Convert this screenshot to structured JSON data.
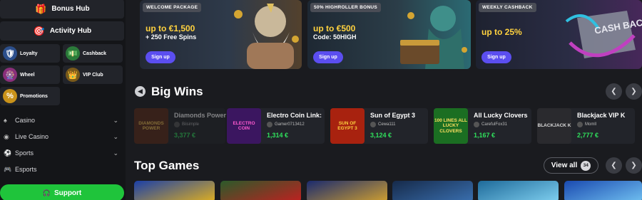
{
  "sidebar": {
    "bonus_hub": "Bonus Hub",
    "activity_hub": "Activity Hub",
    "tiles": [
      {
        "label": "Loyalty",
        "icon": "shield-icon"
      },
      {
        "label": "Cashback",
        "icon": "cash-icon"
      },
      {
        "label": "Wheel",
        "icon": "wheel-icon"
      },
      {
        "label": "VIP Club",
        "icon": "crown-icon"
      },
      {
        "label": "Promotions",
        "icon": "percent-icon"
      }
    ],
    "nav": [
      {
        "label": "Casino",
        "icon": "casino-icon",
        "expandable": true
      },
      {
        "label": "Live Casino",
        "icon": "live-icon",
        "expandable": true
      },
      {
        "label": "Sports",
        "icon": "sports-icon",
        "expandable": true
      },
      {
        "label": "Esports",
        "icon": "gamepad-icon",
        "expandable": false
      }
    ],
    "support": "Support"
  },
  "banners": [
    {
      "tag": "WELCOME PACKAGE",
      "line1": "up to €1,500",
      "line2": "+ 250 Free Spins",
      "button": "Sign up"
    },
    {
      "tag": "50% HIGHROLLER BONUS",
      "line1": "up to €500",
      "line2": "Code: 50HIGH",
      "button": "Sign up"
    },
    {
      "tag": "WEEKLY CASHBACK",
      "line1": "up to 25%",
      "line2": "",
      "button": "Sign up",
      "art_text": "CASH BACK"
    }
  ],
  "big_wins": {
    "title": "Big Wins",
    "items": [
      {
        "game": "Diamonds Power",
        "user": "Biisimple",
        "amount": "3,377 €",
        "thumb": "DIAMONDS POWER",
        "thumb_color": "#5a2a14"
      },
      {
        "game": "Electro Coin Link:",
        "user": "Gamer0713412",
        "amount": "1,314 €",
        "thumb": "ELECTRO COIN",
        "thumb_color": "#3b1660"
      },
      {
        "game": "Sun of Egypt 3",
        "user": "Cewa111",
        "amount": "3,124 €",
        "thumb": "SUN OF EGYPT 3",
        "thumb_color": "#a8220f"
      },
      {
        "game": "All Lucky Clovers",
        "user": "CarefulFox31",
        "amount": "1,167 €",
        "thumb": "100 LINES ALL LUCKY CLOVERS",
        "thumb_color": "#1b6e22"
      },
      {
        "game": "Blackjack VIP K",
        "user": "Momll",
        "amount": "2,777 €",
        "thumb": "BLACKJACK K",
        "thumb_color": "#2a2a2e"
      }
    ]
  },
  "top_games": {
    "title": "Top Games",
    "view_all": "View all",
    "count": "34",
    "tiles": [
      "#1a3fa8",
      "#2b5a2a",
      "#1a2a6e",
      "#162a4a",
      "#1e6a9a",
      "#1a4ab0"
    ]
  },
  "colors": {
    "accent": "#5b4ef0",
    "support": "#1fc43b",
    "win_amount": "#2fe05c",
    "promo_yellow": "#ffd23f"
  }
}
